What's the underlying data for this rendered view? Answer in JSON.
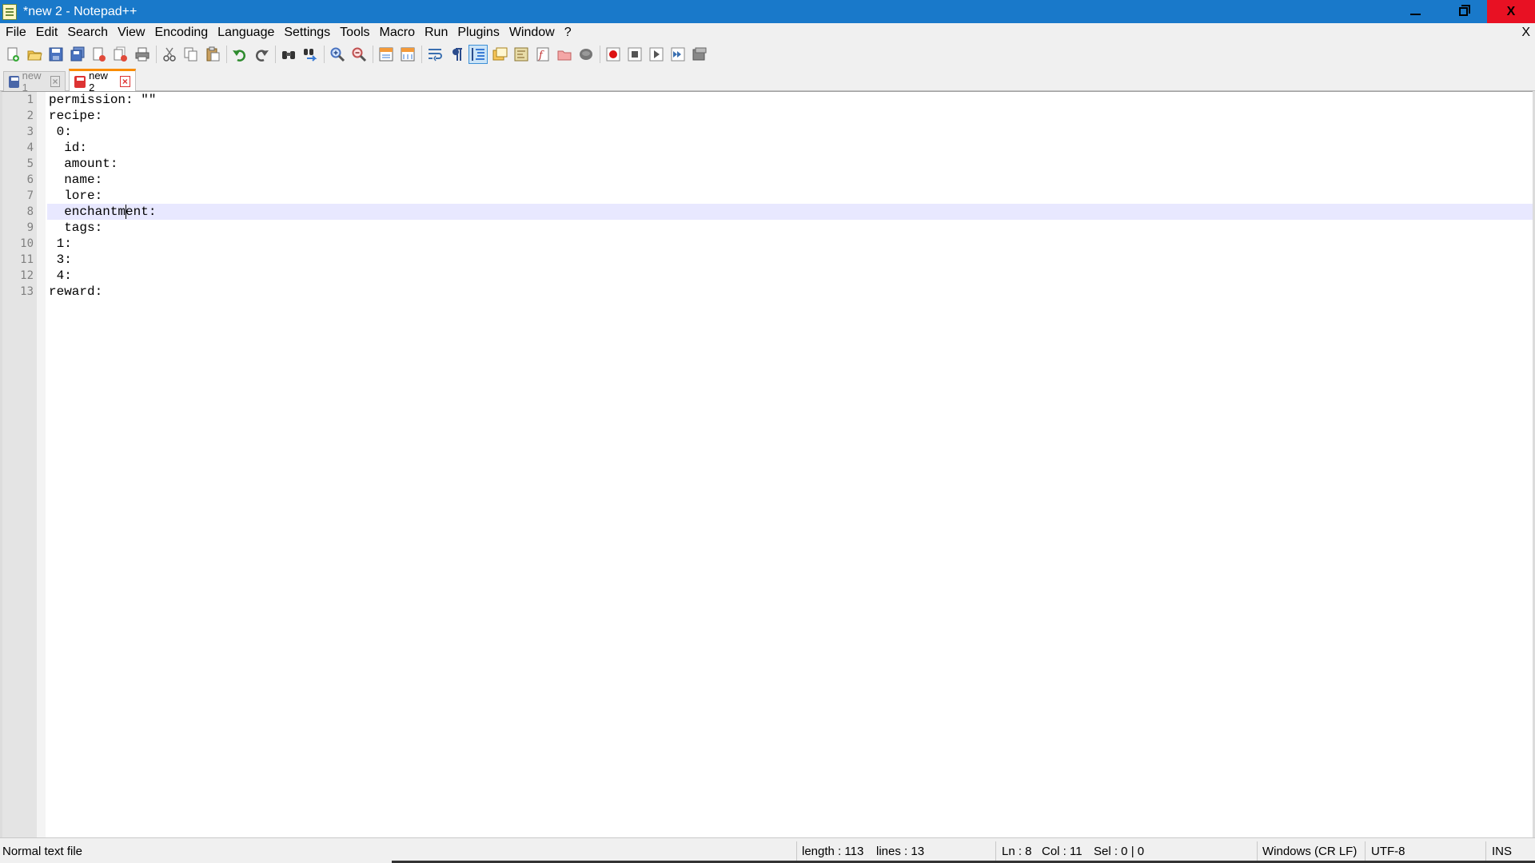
{
  "window": {
    "title": "*new 2 - Notepad++",
    "controls": {
      "minimize": "minimize",
      "restore": "restore",
      "close": "X"
    }
  },
  "menu": {
    "items": [
      "File",
      "Edit",
      "Search",
      "View",
      "Encoding",
      "Language",
      "Settings",
      "Tools",
      "Macro",
      "Run",
      "Plugins",
      "Window",
      "?"
    ],
    "close_doc": "X"
  },
  "toolbar": {
    "buttons": [
      "new-file-icon",
      "open-file-icon",
      "save-icon",
      "save-all-icon",
      "close-icon",
      "close-all-icon",
      "print-icon",
      "cut-icon",
      "copy-icon",
      "paste-icon",
      "undo-icon",
      "redo-icon",
      "find-icon",
      "replace-icon",
      "zoom-in-icon",
      "zoom-out-icon",
      "sync-vertical-icon",
      "sync-horizontal-icon",
      "word-wrap-icon",
      "show-all-chars-icon",
      "indent-guide-icon",
      "user-language-icon",
      "document-map-icon",
      "function-list-icon",
      "folder-workspace-icon",
      "monitoring-icon",
      "record-macro-icon",
      "stop-record-icon",
      "play-macro-icon",
      "run-multiple-macro-icon",
      "save-macro-icon"
    ],
    "active_button": "indent-guide-icon"
  },
  "tabs": [
    {
      "label": "new 1",
      "active": false,
      "modified": false
    },
    {
      "label": "new 2",
      "active": true,
      "modified": true
    }
  ],
  "editor": {
    "lines": [
      "permission: \"\"",
      "recipe:",
      " 0:",
      "  id:",
      "  amount:",
      "  name:",
      "  lore:",
      "  enchantment:",
      "  tags:",
      " 1:",
      " 3:",
      " 4:",
      "reward:"
    ],
    "current_line": 8,
    "caret_col": 11
  },
  "status": {
    "file_type": "Normal text file",
    "length": "length : 113",
    "lines": "lines : 13",
    "ln": "Ln : 8",
    "col": "Col : 11",
    "sel": "Sel : 0 | 0",
    "eol": "Windows (CR LF)",
    "encoding": "UTF-8",
    "mode": "INS"
  },
  "colors": {
    "titlebar": "#1979ca",
    "current_line": "#e8e8ff",
    "active_tab_accent": "#fa8c00",
    "close_button": "#e81123"
  }
}
